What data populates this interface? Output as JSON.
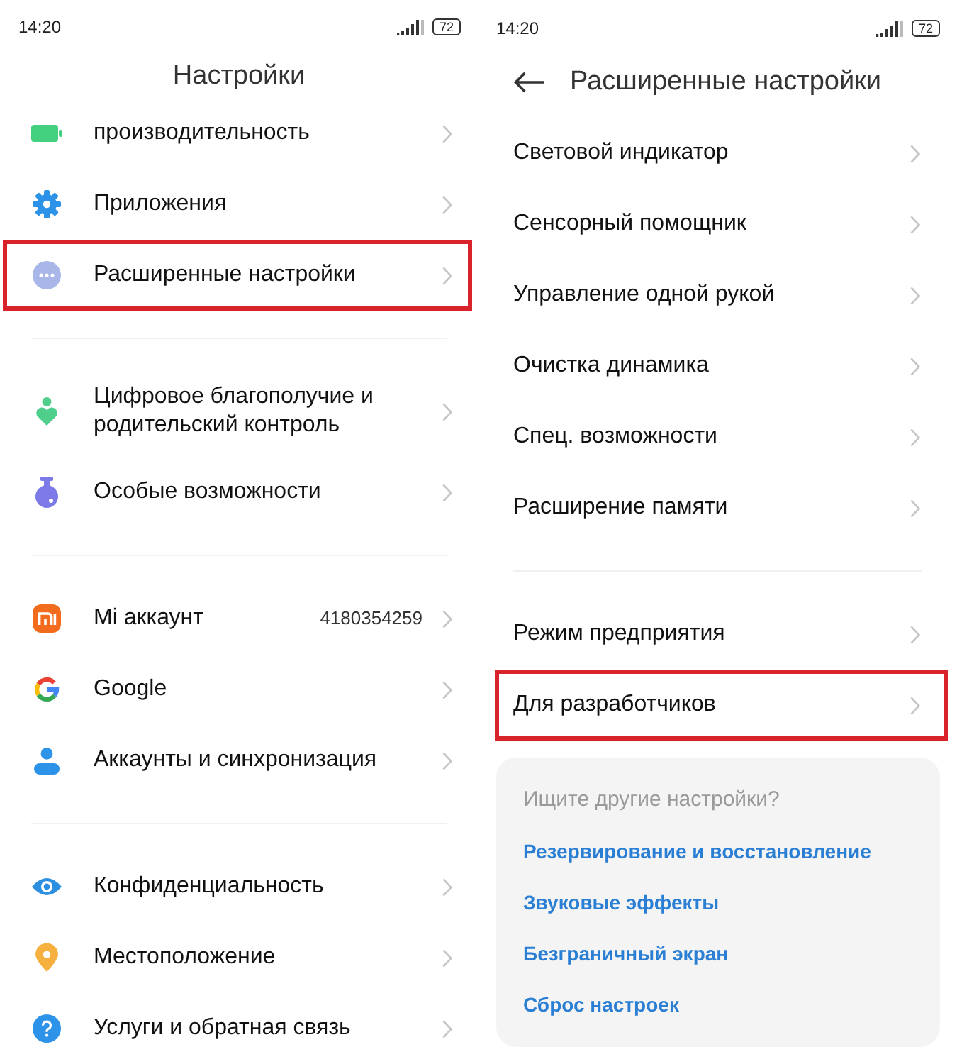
{
  "left_screen": {
    "status_bar": {
      "time": "14:20",
      "battery": "72"
    },
    "title": "Настройки",
    "groups": [
      {
        "items": [
          {
            "label": "производительность",
            "highlighted": false
          },
          {
            "label": "Приложения",
            "highlighted": false
          },
          {
            "label": "Расширенные настройки",
            "highlighted": true
          }
        ]
      },
      {
        "items": [
          {
            "label": "Цифровое благополучие и родительский контроль",
            "highlighted": false
          },
          {
            "label": "Особые возможности",
            "highlighted": false
          }
        ]
      },
      {
        "items": [
          {
            "label": "Mi аккаунт",
            "value": "4180354259",
            "highlighted": false
          },
          {
            "label": "Google",
            "highlighted": false
          },
          {
            "label": "Аккаунты и синхронизация",
            "highlighted": false
          }
        ]
      },
      {
        "items": [
          {
            "label": "Конфиденциальность",
            "highlighted": false
          },
          {
            "label": "Местоположение",
            "highlighted": false
          },
          {
            "label": "Услуги и обратная связь",
            "highlighted": false
          }
        ]
      }
    ]
  },
  "right_screen": {
    "status_bar": {
      "time": "14:20",
      "battery": "72"
    },
    "title": "Расширенные настройки",
    "groups": [
      {
        "items": [
          {
            "label": "Световой индикатор",
            "highlighted": false
          },
          {
            "label": "Сенсорный помощник",
            "highlighted": false
          },
          {
            "label": "Управление одной рукой",
            "highlighted": false
          },
          {
            "label": "Очистка динамика",
            "highlighted": false
          },
          {
            "label": "Спец. возможности",
            "highlighted": false
          },
          {
            "label": "Расширение памяти",
            "highlighted": false
          }
        ]
      },
      {
        "items": [
          {
            "label": "Режим предприятия",
            "highlighted": false
          },
          {
            "label": "Для разработчиков",
            "highlighted": true
          }
        ]
      }
    ],
    "suggestions": {
      "title": "Ищите другие настройки?",
      "links": [
        "Резервирование и восстановление",
        "Звуковые эффекты",
        "Безграничный экран",
        "Сброс настроек"
      ]
    }
  }
}
